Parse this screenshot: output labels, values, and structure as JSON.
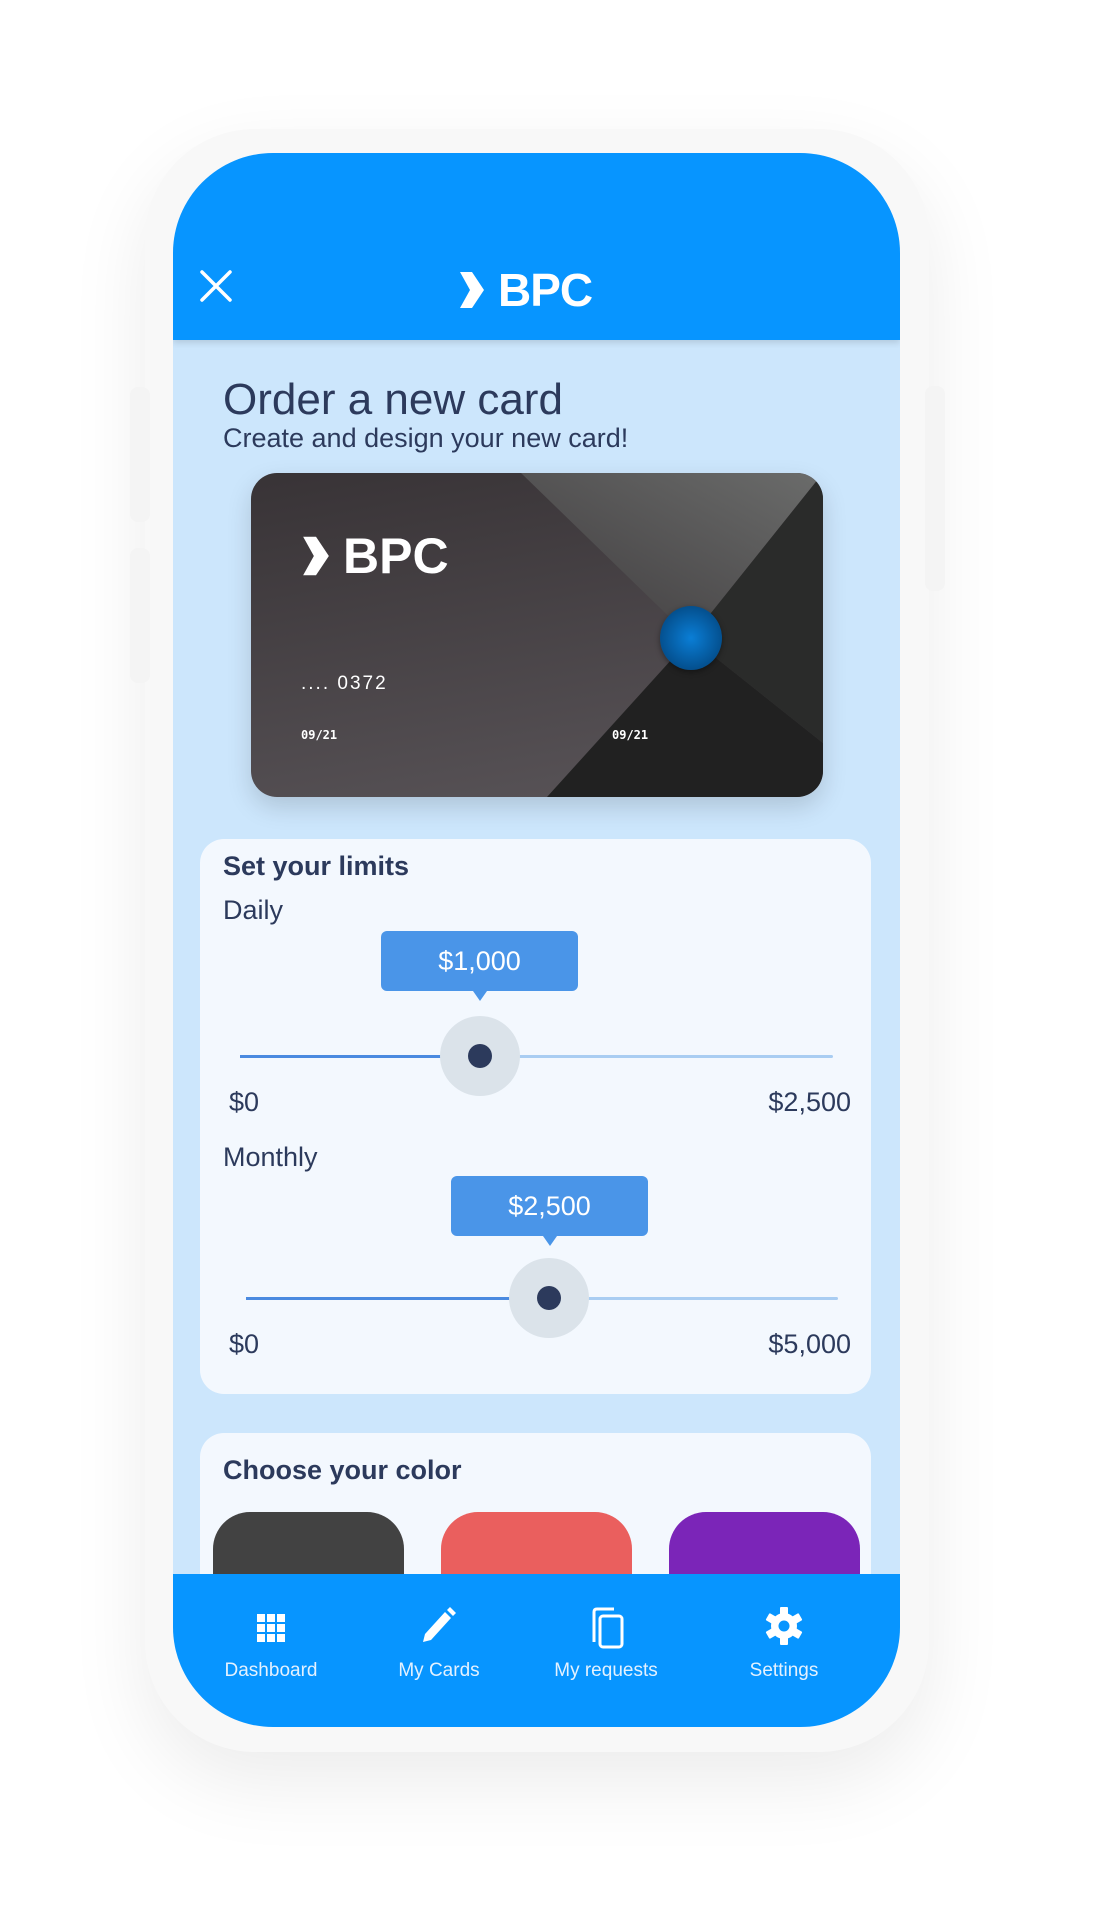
{
  "header": {
    "logo": "BPC",
    "close_icon": "close-icon"
  },
  "page": {
    "title": "Order a new card",
    "subtitle": "Create and design your new card!"
  },
  "card": {
    "logo": "BPC",
    "number": ".... 0372",
    "expiry_left": "09/21",
    "expiry_right": "09/21"
  },
  "limits": {
    "title": "Set your limits",
    "daily": {
      "label": "Daily",
      "value": "$1,000",
      "min": "$0",
      "max": "$2,500",
      "fraction": 0.4
    },
    "monthly": {
      "label": "Monthly",
      "value": "$2,500",
      "min": "$0",
      "max": "$5,000",
      "fraction": 0.5
    }
  },
  "colors": {
    "title": "Choose your color",
    "swatches": [
      "#424242",
      "#ea5f5e",
      "#7b25b8"
    ]
  },
  "nav": {
    "items": [
      {
        "label": "Dashboard",
        "icon": "grid-icon"
      },
      {
        "label": "My Cards",
        "icon": "pencil-icon"
      },
      {
        "label": "My requests",
        "icon": "copy-icon"
      },
      {
        "label": "Settings",
        "icon": "gear-icon"
      }
    ]
  },
  "theme": {
    "primary": "#0795ff",
    "background": "#cce6fc",
    "panel": "#f3f8fe",
    "text": "#2c3a5c",
    "tooltip": "#4a95e8"
  }
}
